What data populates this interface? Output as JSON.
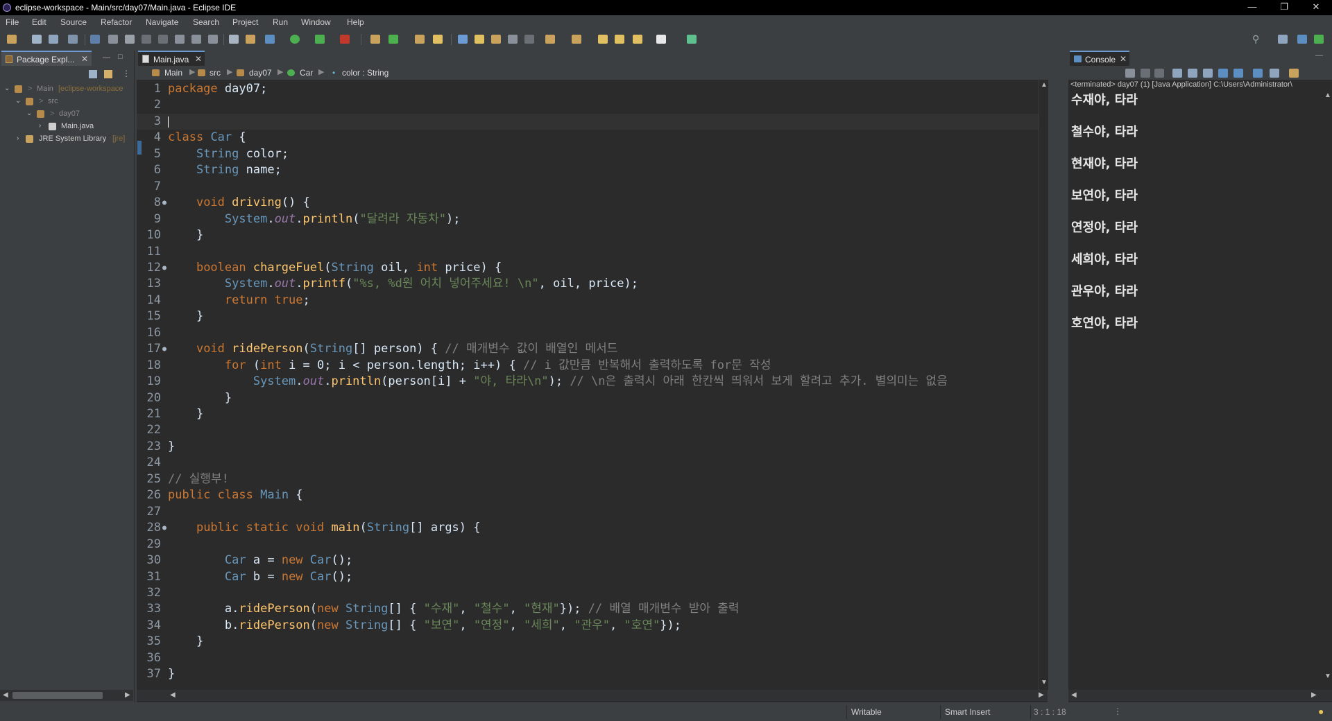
{
  "window": {
    "title": "eclipse-workspace - Main/src/day07/Main.java - Eclipse IDE"
  },
  "menu": [
    "File",
    "Edit",
    "Source",
    "Refactor",
    "Navigate",
    "Search",
    "Project",
    "Run",
    "Window",
    "Help"
  ],
  "package_explorer": {
    "tab_label": "Package Expl...",
    "tree": [
      {
        "label": "Main",
        "suffix": "[eclipse-workspace",
        "expanded": true
      },
      {
        "label": "src",
        "expanded": true
      },
      {
        "label": "day07",
        "expanded": true
      },
      {
        "label": "Main.java",
        "expanded": false
      },
      {
        "label": "JRE System Library",
        "suffix": "[jre]",
        "expanded": false
      }
    ]
  },
  "editor": {
    "tab_label": "Main.java",
    "breadcrumb": [
      "Main",
      "src",
      "day07",
      "Car",
      "color : String"
    ],
    "current_line": 3
  },
  "console": {
    "tab_label": "Console",
    "status": "<terminated> day07 (1) [Java Application] C:\\Users\\Administrator\\",
    "lines": [
      "수재야, 타라",
      "철수야, 타라",
      "현재야, 타라",
      "보연야, 타라",
      "연정야, 타라",
      "세희야, 타라",
      "관우야, 타라",
      "호연야, 타라"
    ]
  },
  "statusbar": {
    "writable": "Writable",
    "insert_mode": "Smart Insert",
    "position": "3 : 1 : 18"
  },
  "code_lines": [
    "package day07;",
    "",
    "",
    "class Car {",
    "    String color;",
    "    String name;",
    "",
    "    void driving() {",
    "        System.out.println(\"달려라 자동차\");",
    "    }",
    "",
    "    boolean chargeFuel(String oil, int price) {",
    "        System.out.printf(\"%s, %d원 어치 넣어주세요! \\n\", oil, price);",
    "        return true;",
    "    }",
    "",
    "    void ridePerson(String[] person) { // 매개변수 값이 배열인 메서드",
    "        for (int i = 0; i < person.length; i++) { // i 값만큼 반복해서 출력하도록 for문 작성",
    "            System.out.println(person[i] + \"야, 타라\\n\"); // \\n은 출력시 아래 한칸씩 띄워서 보게 할려고 추가. 별의미는 없음",
    "        }",
    "    }",
    "",
    "}",
    "",
    "// 실행부!",
    "public class Main {",
    "",
    "    public static void main(String[] args) {",
    "",
    "        Car a = new Car();",
    "        Car b = new Car();",
    "",
    "        a.ridePerson(new String[] { \"수재\", \"철수\", \"현재\"}); // 배열 매개변수 받아 출력",
    "        b.ridePerson(new String[] { \"보연\", \"연정\", \"세희\", \"관우\", \"호연\"});",
    "    }",
    "",
    "}"
  ],
  "colors": {
    "background": "#2b2b2b",
    "chrome": "#3c3f41",
    "keyword": "#cc7832",
    "type": "#6897bb",
    "string": "#6a8759",
    "comment": "#808080"
  },
  "icons": [
    "new-icon",
    "save-icon",
    "run-icon",
    "debug-icon",
    "search-icon",
    "package-icon",
    "java-file-icon",
    "console-icon",
    "close-icon",
    "minimize-icon",
    "maximize-icon"
  ]
}
